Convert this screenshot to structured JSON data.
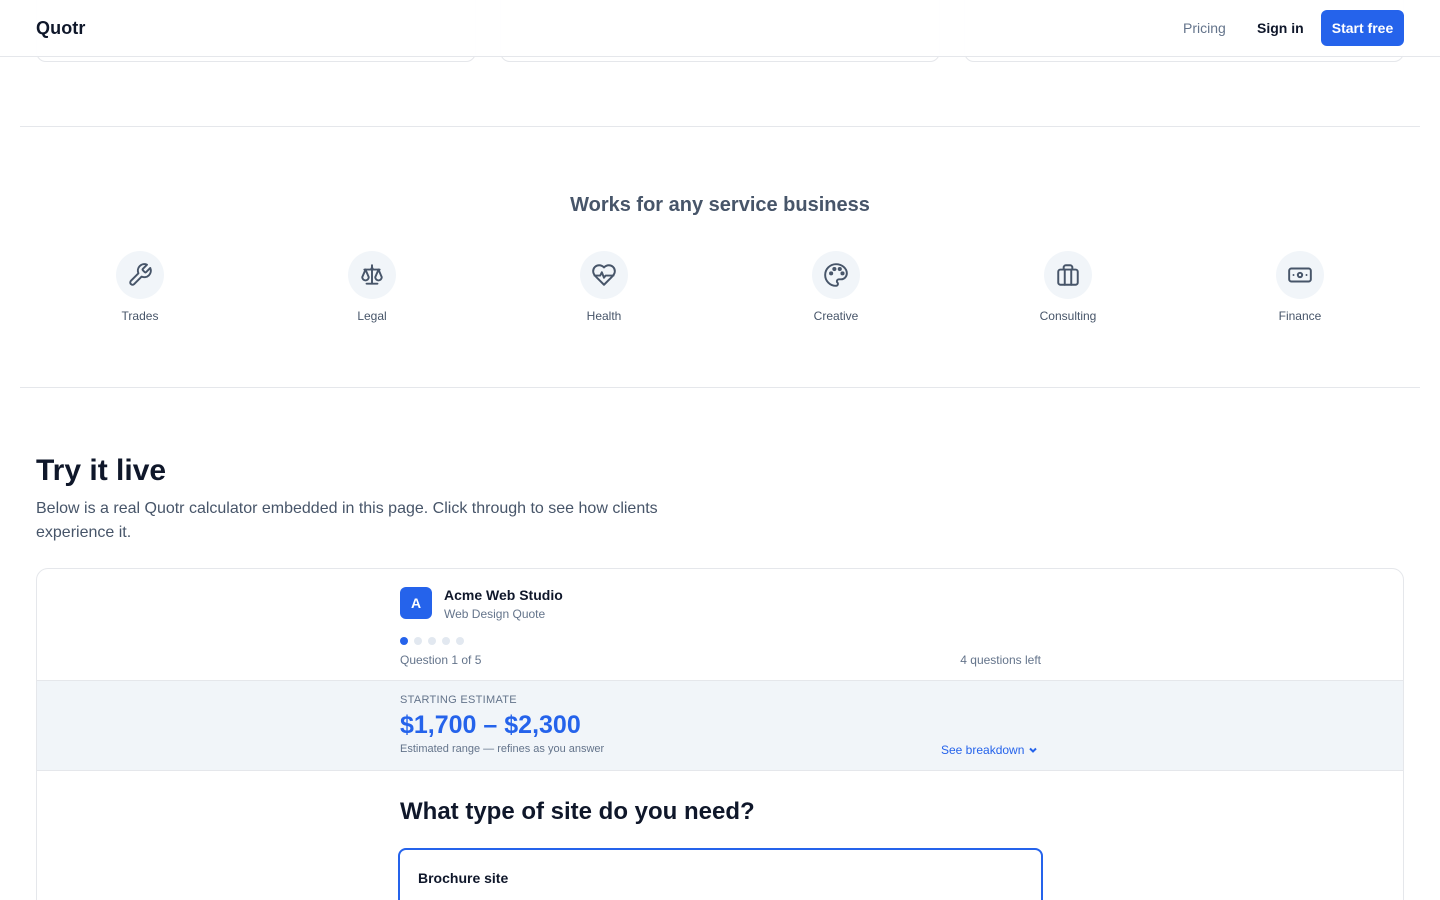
{
  "nav": {
    "logo": "Quotr",
    "pricing": "Pricing",
    "sign_in": "Sign in",
    "start_free": "Start free"
  },
  "industries": {
    "heading": "Works for any service business",
    "items": [
      {
        "label": "Trades",
        "icon": "wrench-icon"
      },
      {
        "label": "Legal",
        "icon": "scale-icon"
      },
      {
        "label": "Health",
        "icon": "heart-pulse-icon"
      },
      {
        "label": "Creative",
        "icon": "palette-icon"
      },
      {
        "label": "Consulting",
        "icon": "briefcase-icon"
      },
      {
        "label": "Finance",
        "icon": "banknote-icon"
      }
    ]
  },
  "try_live": {
    "title": "Try it live",
    "description": "Below is a real Quotr calculator embedded in this page. Click through to see how clients experience it."
  },
  "calculator": {
    "avatar_letter": "A",
    "business_name": "Acme Web Studio",
    "subtitle": "Web Design Quote",
    "progress_total": 5,
    "progress_current": 1,
    "question_progress": "Question 1 of 5",
    "questions_left": "4 questions left",
    "estimate": {
      "label": "STARTING ESTIMATE",
      "range": "$1,700 – $2,300",
      "note": "Estimated range — refines as you answer",
      "breakdown_link": "See breakdown"
    },
    "question": "What type of site do you need?",
    "options": [
      "Brochure site"
    ]
  },
  "colors": {
    "accent": "#2563eb",
    "text": "#0f172a",
    "muted": "#64748b",
    "band": "#f1f5f9"
  }
}
